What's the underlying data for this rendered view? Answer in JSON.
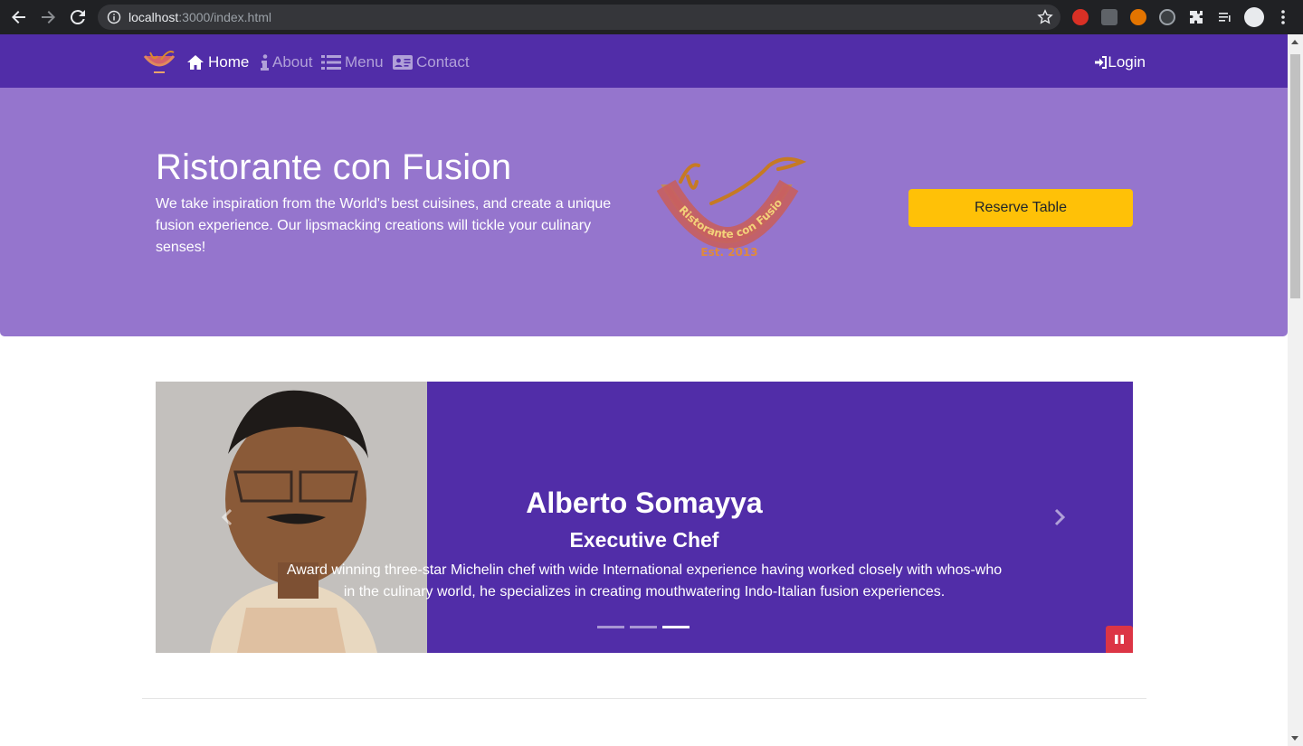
{
  "browser": {
    "url_host": "localhost",
    "url_rest": ":3000/index.html"
  },
  "navbar": {
    "items": [
      {
        "label": "Home",
        "icon": "home-icon",
        "active": true
      },
      {
        "label": "About",
        "icon": "info-icon",
        "active": false
      },
      {
        "label": "Menu",
        "icon": "list-icon",
        "active": false
      },
      {
        "label": "Contact",
        "icon": "address-card-icon",
        "active": false
      }
    ],
    "login_label": "Login"
  },
  "jumbotron": {
    "title": "Ristorante con Fusion",
    "text": "We take inspiration from the World's best cuisines, and create a unique fusion experience. Our lipsmacking creations will tickle your culinary senses!",
    "logo_text": "Ristorante con Fusion",
    "logo_est": "Est. 2013",
    "reserve_label": "Reserve Table"
  },
  "carousel": {
    "name": "Alberto Somayya",
    "role": "Executive Chef",
    "description": "Award winning three-star Michelin chef with wide International experience having worked closely with whos-who in the culinary world, he specializes in creating mouthwatering Indo-Italian fusion experiences.",
    "slide_count": 3,
    "active_slide": 3
  },
  "colors": {
    "primary": "#512da8",
    "jumbotron": "#9575cd",
    "warning": "#ffc107",
    "danger": "#dc3545"
  }
}
